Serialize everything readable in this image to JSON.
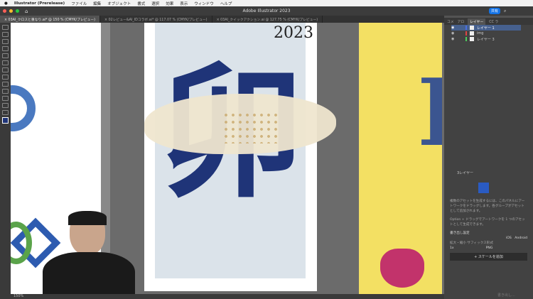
{
  "menubar": {
    "apple": "",
    "app": "Illustrator (Prerelease)",
    "items": [
      "ファイル",
      "編集",
      "オブジェクト",
      "書式",
      "選択",
      "効果",
      "表示",
      "ウィンドウ",
      "ヘルプ"
    ]
  },
  "window": {
    "title": "Adobe Illustrator 2023",
    "share": "共有"
  },
  "tabs": [
    {
      "label": "× 03AI_クロスと重なり.ai* @ 150 % (CMYK/プレビュー)",
      "active": true
    },
    {
      "label": "× 02レビュー&AI_IDコラボ.ai* @ 117.07 % (CMYK/プレビュー)",
      "active": false
    },
    {
      "label": "× 03AI_クイックアクション.ai @ 127.75 % (CMYK/プレビュー)",
      "active": false
    }
  ],
  "artwork": {
    "year": "2023",
    "kanji": "卯",
    "kanji_right": "E",
    "navy": "#1f3478",
    "bg_blue": "#dbe3ea",
    "yellow": "#f3e063"
  },
  "status": {
    "zoom": "150%"
  },
  "panel": {
    "tabs": [
      "コメ",
      "アロ",
      "レイヤー",
      "CC ラ"
    ],
    "layers": [
      {
        "name": "レイヤー 1",
        "color": "#4b6fe0"
      },
      {
        "name": "img",
        "color": "#e04444"
      },
      {
        "name": "レイヤー 3",
        "color": "#4ccf5a"
      }
    ],
    "layer_count": "3レイヤー",
    "asset_text": "複数のアセットを生成するには、このパネルにアートワークをドラッグします。各グループがアセットとして追加されます。",
    "option_text": "Option + ドラッグでアートワークを 1 つのアセットとして生成できます。",
    "export_settings": "書き出し設定",
    "ios": "iOS",
    "android": "Android",
    "scale_label": "拡大・縮小  サフィックス形式",
    "scale": "1x",
    "format": "PNG",
    "add_scale": "+ スケールを追加",
    "export": "書き出し..."
  }
}
